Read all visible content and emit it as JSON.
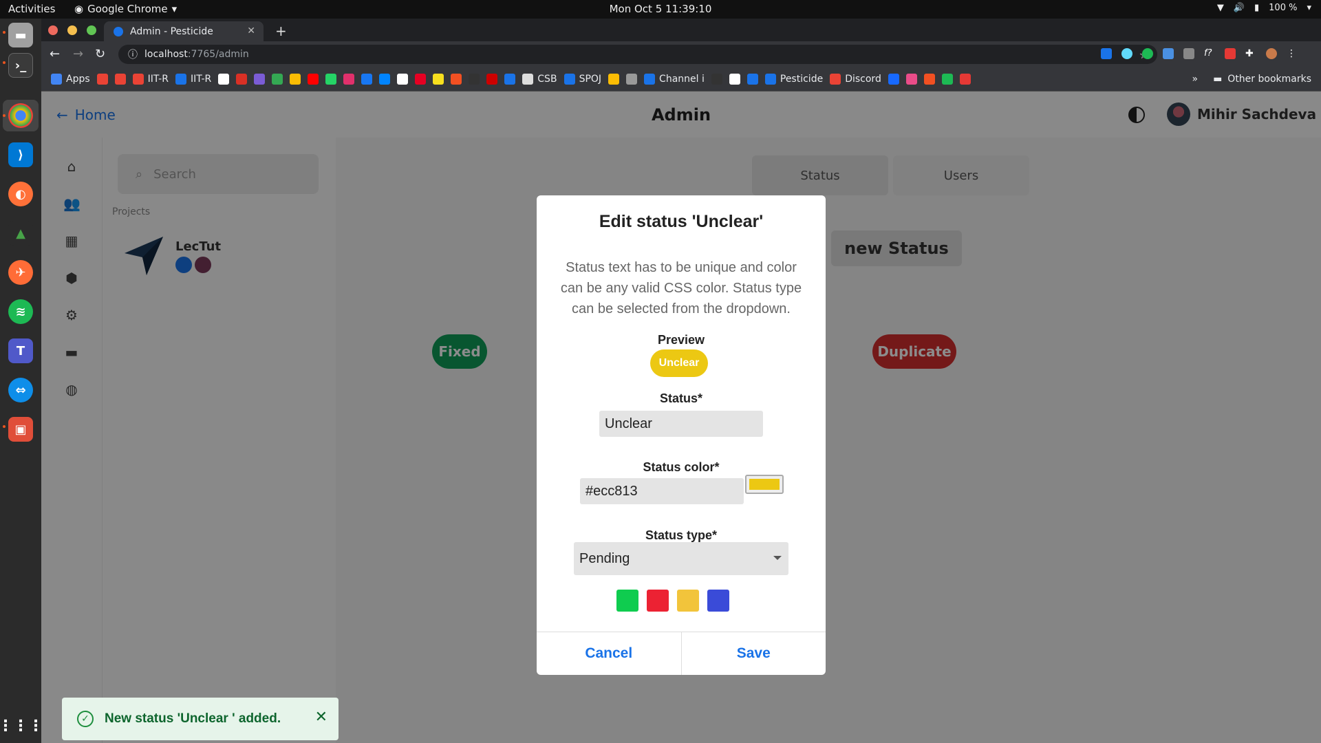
{
  "gnome": {
    "activities": "Activities",
    "app_name": "Google Chrome",
    "clock": "Mon Oct 5  11:39:10",
    "battery": "100 %"
  },
  "chrome": {
    "tab_title": "Admin - Pesticide",
    "url_host": "localhost",
    "url_path": ":7765/admin",
    "bookmarks": [
      {
        "label": "Apps",
        "color": "#4285f4"
      },
      {
        "label": "",
        "color": "#ea4335"
      },
      {
        "label": "",
        "color": "#ea4335"
      },
      {
        "label": "IIT-R",
        "color": "#ea4335"
      },
      {
        "label": "IIT-R",
        "color": "#1a73e8"
      },
      {
        "label": "",
        "color": "#ffffff"
      },
      {
        "label": "",
        "color": "#d93025"
      },
      {
        "label": "",
        "color": "#7b5cd6"
      },
      {
        "label": "",
        "color": "#34a853"
      },
      {
        "label": "",
        "color": "#fbbc04"
      },
      {
        "label": "",
        "color": "#ff0000"
      },
      {
        "label": "",
        "color": "#25d366"
      },
      {
        "label": "",
        "color": "#e1306c"
      },
      {
        "label": "",
        "color": "#1877f2"
      },
      {
        "label": "",
        "color": "#0084ff"
      },
      {
        "label": "",
        "color": "#ffffff"
      },
      {
        "label": "",
        "color": "#e60023"
      },
      {
        "label": "",
        "color": "#f7df1e"
      },
      {
        "label": "",
        "color": "#f25022"
      },
      {
        "label": "",
        "color": "#333333"
      },
      {
        "label": "",
        "color": "#cc0000"
      },
      {
        "label": "",
        "color": "#1a73e8"
      },
      {
        "label": "CSB",
        "color": "#dddddd"
      },
      {
        "label": "SPOJ",
        "color": "#1a73e8"
      },
      {
        "label": "",
        "color": "#fbbc04"
      },
      {
        "label": "",
        "color": "#999999"
      },
      {
        "label": "Channel i",
        "color": "#1a73e8"
      },
      {
        "label": "",
        "color": "#333333"
      },
      {
        "label": "",
        "color": "#ffffff"
      },
      {
        "label": "",
        "color": "#1a73e8"
      },
      {
        "label": "Pesticide",
        "color": "#1a73e8"
      },
      {
        "label": "Discord",
        "color": "#ea4335"
      },
      {
        "label": "",
        "color": "#1769ff"
      },
      {
        "label": "",
        "color": "#ea4c89"
      },
      {
        "label": "",
        "color": "#f25022"
      },
      {
        "label": "",
        "color": "#1db954"
      },
      {
        "label": "",
        "color": "#e53935"
      }
    ],
    "other_bookmarks": "Other bookmarks"
  },
  "app": {
    "home_link": "Home",
    "page_title": "Admin",
    "user_name": "Mihir Sachdeva",
    "search_placeholder": "Search",
    "projects_heading": "Projects",
    "project_name": "LecTut",
    "tabs": [
      "Status",
      "Users"
    ],
    "new_status_label": "new Status",
    "status_pills": [
      {
        "label": "Fixed",
        "color": "#0f9d58"
      },
      {
        "label": "Duplicate",
        "color": "#d32f2f"
      }
    ]
  },
  "modal": {
    "title": "Edit status 'Unclear'",
    "description": "Status text has to be unique and color can be any valid CSS color. Status type can be selected from the dropdown.",
    "preview_label": "Preview",
    "preview_text": "Unclear",
    "preview_color": "#ecc813",
    "status_label": "Status*",
    "status_value": "Unclear",
    "color_label": "Status color*",
    "color_value": "#ecc813",
    "type_label": "Status type*",
    "type_value": "Pending",
    "swatches": [
      "#0fcc4f",
      "#ec2233",
      "#f2c43b",
      "#3a4bd8"
    ],
    "cancel_label": "Cancel",
    "save_label": "Save"
  },
  "toast": {
    "message": "New status 'Unclear ' added.",
    "bg_color": "#e6f4ea"
  }
}
